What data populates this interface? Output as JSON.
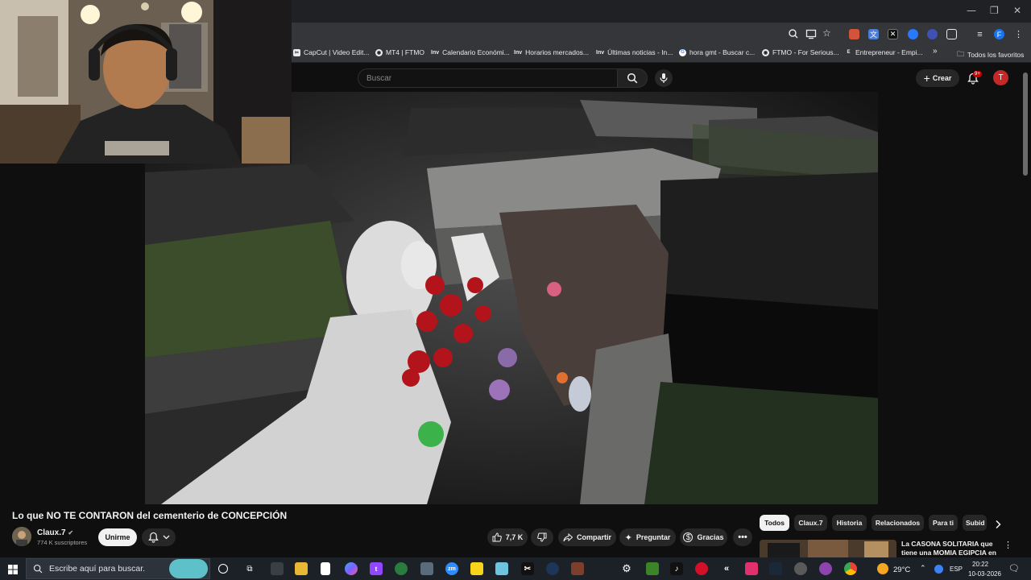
{
  "browser": {
    "bookmarks": [
      {
        "label": "CapCut | Video Edit...",
        "icon": "capcut-icon"
      },
      {
        "label": "MT4 | FTMO",
        "icon": "ftmo-icon"
      },
      {
        "label": "Calendario Económi...",
        "icon": "investing-icon"
      },
      {
        "label": "Horarios mercados...",
        "icon": "investing-icon"
      },
      {
        "label": "Últimas noticias - In...",
        "icon": "investing-icon"
      },
      {
        "label": "hora gmt - Buscar c...",
        "icon": "google-icon"
      },
      {
        "label": "FTMO - For Serious...",
        "icon": "ftmo-icon"
      },
      {
        "label": "Entrepreneur - Empi...",
        "icon": "entrepreneur-icon"
      }
    ],
    "bookmarks_more": "»",
    "all_bookmarks": "Todos los favoritos",
    "profile_initial": "F",
    "colors": {
      "frame": "#202124",
      "toolbar": "#35363a"
    }
  },
  "youtube": {
    "search_placeholder": "Buscar",
    "create_label": "Crear",
    "notif_badge": "9+",
    "avatar_initial": "T",
    "video": {
      "title": "Lo que NO TE CONTARON del cementerio de CONCEPCIÓN",
      "channel": "Claux.7",
      "subscribers": "774 K suscriptores",
      "join_label": "Unirme",
      "likes": "7,7 K",
      "share_label": "Compartir",
      "ask_label": "Preguntar",
      "thanks_label": "Gracias"
    },
    "chips": [
      "Todos",
      "Claux.7",
      "Historia",
      "Relacionados",
      "Para ti",
      "Subid"
    ],
    "recommendation": {
      "title": "La CASONA SOLITARIA que tiene una MOMIA EGIPCIA en ..."
    },
    "colors": {
      "bg": "#0f0f0f",
      "pill": "#272727",
      "accent": "#cc0000"
    }
  },
  "taskbar": {
    "search_placeholder": "Escribe aquí para buscar.",
    "weather": "29°C",
    "language": "ESP",
    "time": "20:22",
    "date": "10-03-2026"
  }
}
